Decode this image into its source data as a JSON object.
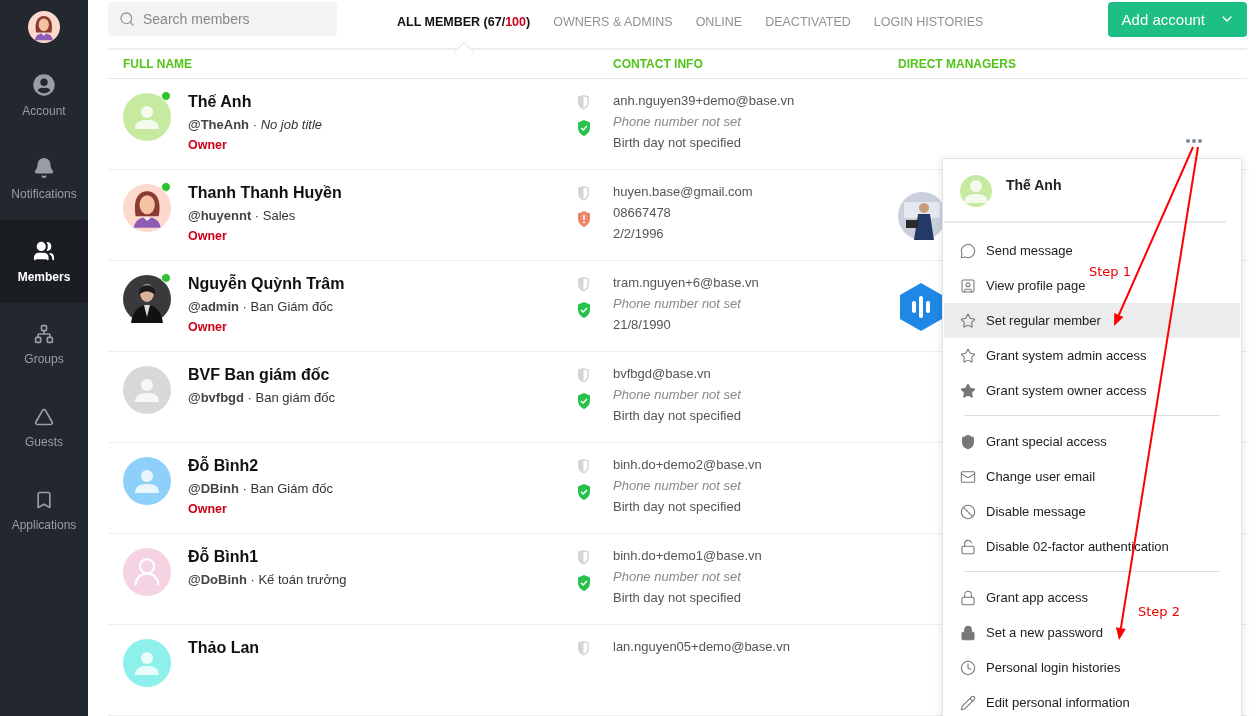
{
  "sidebar": {
    "items": [
      {
        "kind": "account",
        "label": "Account",
        "selected": false
      },
      {
        "kind": "notifications",
        "label": "Notifications",
        "selected": false
      },
      {
        "kind": "members",
        "label": "Members",
        "selected": true
      },
      {
        "kind": "groups",
        "label": "Groups",
        "selected": false
      },
      {
        "kind": "guests",
        "label": "Guests",
        "selected": false
      },
      {
        "kind": "applications",
        "label": "Applications",
        "selected": false
      }
    ]
  },
  "search": {
    "placeholder": "Search members"
  },
  "tabs": [
    {
      "segments": [
        "ALL MEMBER (67/",
        "100",
        ")"
      ],
      "selected": true
    },
    {
      "segments": [
        "OWNERS & ADMINS"
      ],
      "selected": false
    },
    {
      "segments": [
        "ONLINE"
      ],
      "selected": false
    },
    {
      "segments": [
        "DEACTIVATED"
      ],
      "selected": false
    },
    {
      "segments": [
        "LOGIN HISTORIES"
      ],
      "selected": false
    }
  ],
  "add_button": {
    "label": "Add account"
  },
  "table": {
    "columns": [
      "FULL NAME",
      "CONTACT INFO",
      "DIRECT MANAGERS"
    ],
    "rows": [
      {
        "name": "Thế Anh",
        "subtitle": "**@TheAnh** · *No job title*",
        "role": "Owner",
        "online": true,
        "avatar": {
          "kind": "placeholder",
          "color": "#c6eba0"
        },
        "verified": true,
        "email": "anh.nguyen39+demo@base.vn",
        "phone": "Phone number not set",
        "phone_missing": true,
        "birthday": "Birth day not specified"
      },
      {
        "name": "Thanh Thanh Huyền",
        "subtitle": "**@huyennt** · Sales",
        "role": "Owner",
        "online": true,
        "avatar": {
          "kind": "illustration",
          "color": "#fcd9cc"
        },
        "verified": false,
        "email": "huyen.base@gmail.com",
        "phone": "08667478",
        "phone_missing": false,
        "birthday": "2/2/1996"
      },
      {
        "name": "Nguyễn Quỳnh Trâm",
        "subtitle": "**@admin** · Ban Giám đốc",
        "role": "Owner",
        "online": true,
        "verified": true,
        "email": "tram.nguyen+6@base.vn",
        "phone": "Phone number not set",
        "phone_missing": true,
        "birthday": "21/8/1990",
        "manager": {
          "kind": "logo"
        }
      },
      {
        "name": "BVF Ban giám đốc",
        "subtitle": "**@bvfbgd** · Ban giám đốc",
        "online": false,
        "avatar": {
          "kind": "placeholder",
          "color": "#d8d8d6"
        },
        "verified": true,
        "email": "bvfbgd@base.vn",
        "phone": "Phone number not set",
        "phone_missing": true,
        "birthday": "Birth day not specified"
      },
      {
        "name": "Đỗ Bình2",
        "subtitle": "**@DBinh** · Ban Giám đốc",
        "role": "Owner",
        "online": false,
        "avatar": {
          "kind": "placeholder",
          "color": "#8fd0fb"
        },
        "verified": true,
        "email": "binh.do+demo2@base.vn",
        "phone": "Phone number not set",
        "phone_missing": true,
        "birthday": "Birth day not specified"
      },
      {
        "name": "Đỗ Bình1",
        "subtitle": "**@DoBinh** · Kế toán trưởng",
        "online": false,
        "avatar": {
          "kind": "outline",
          "color": "#f6d3e3"
        },
        "verified": true,
        "email": "binh.do+demo1@base.vn",
        "phone": "Phone number not set",
        "phone_missing": true,
        "birthday": "Birth day not specified"
      },
      {
        "name": "Thảo Lan",
        "online": false,
        "avatar": {
          "kind": "placeholder",
          "color": "#8ef0ea"
        },
        "email": "lan.nguyen05+demo@base.vn"
      }
    ]
  },
  "menu": {
    "name": "Thế Anh",
    "sections": [
      [
        {
          "label": "Send message",
          "selected": false
        },
        {
          "label": "View profile page",
          "selected": false
        },
        {
          "label": "Set regular member",
          "selected": true
        },
        {
          "label": "Grant system admin access",
          "selected": false
        },
        {
          "label": "Grant system owner access",
          "selected": false
        }
      ],
      [
        {
          "label": "Grant special access",
          "selected": false
        },
        {
          "label": "Change user email",
          "selected": false
        },
        {
          "label": "Disable message",
          "selected": false
        },
        {
          "label": "Disable 02-factor authentication",
          "selected": false
        }
      ],
      [
        {
          "label": "Grant app access",
          "selected": false
        },
        {
          "label": "Set a new password",
          "selected": false
        },
        {
          "label": "Personal login histories",
          "selected": false
        },
        {
          "label": "Edit personal information",
          "selected": false
        }
      ]
    ]
  },
  "annotations": [
    {
      "label": "Step 1"
    },
    {
      "label": "Step 2"
    }
  ]
}
